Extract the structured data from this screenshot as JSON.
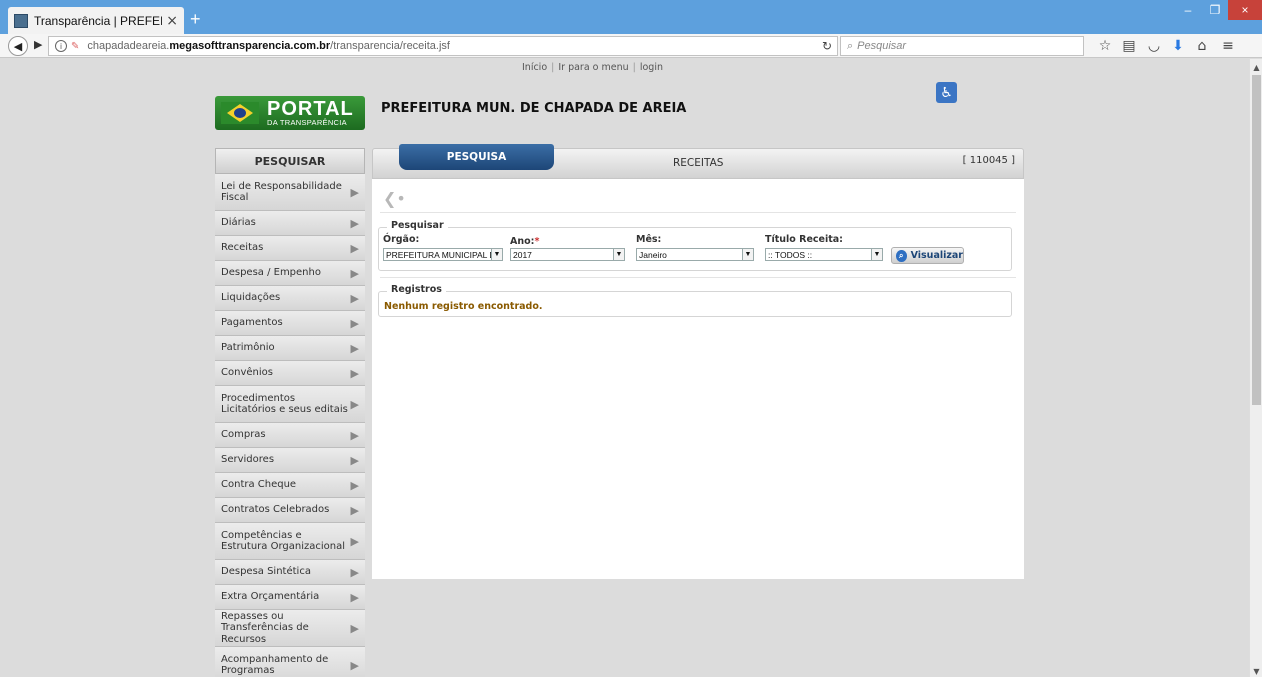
{
  "browser": {
    "tab_title": "Transparência | PREFEITU...",
    "tab_close": "×",
    "new_tab": "+",
    "window_buttons": {
      "minimize": "–",
      "restore": "❐",
      "close": "×"
    },
    "url_host": "chapadadeareia.",
    "url_strong": "megasofttransparencia.com.br",
    "url_path": "/transparencia/receita.jsf",
    "search_placeholder": "Pesquisar"
  },
  "toplinks": {
    "inicio": "Início",
    "menu": "Ir para o menu",
    "login": "login"
  },
  "logo": {
    "main": "PORTAL",
    "sub": "DA TRANSPARÊNCIA"
  },
  "page_title": "PREFEITURA MUN. DE CHAPADA DE AREIA",
  "sidebar": {
    "header": "PESQUISAR",
    "items": [
      {
        "label": "Lei de Responsabilidade Fiscal"
      },
      {
        "label": "Diárias"
      },
      {
        "label": "Receitas"
      },
      {
        "label": "Despesa / Empenho"
      },
      {
        "label": "Liquidações"
      },
      {
        "label": "Pagamentos"
      },
      {
        "label": "Patrimônio"
      },
      {
        "label": "Convênios"
      },
      {
        "label": "Procedimentos Licitatórios e seus editais"
      },
      {
        "label": "Compras"
      },
      {
        "label": "Servidores"
      },
      {
        "label": "Contra Cheque"
      },
      {
        "label": "Contratos Celebrados"
      },
      {
        "label": "Competências e Estrutura Organizacional"
      },
      {
        "label": "Despesa Sintética"
      },
      {
        "label": "Extra Orçamentária"
      },
      {
        "label": "Repasses ou Transferências de Recursos"
      },
      {
        "label": "Acompanhamento de Programas"
      }
    ]
  },
  "main": {
    "tab_pesquisa": "PESQUISA",
    "tab_receitas": "RECEITAS",
    "code": "[ 110045 ]",
    "pesquisar_legend": "Pesquisar",
    "orgao_label": "Órgão:",
    "orgao_value": "PREFEITURA MUNICIPAL D",
    "ano_label": "Ano:",
    "ano_required": "*",
    "ano_value": "2017",
    "mes_label": "Mês:",
    "mes_value": "Janeiro",
    "titulo_label": "Título Receita:",
    "titulo_value": ":: TODOS ::",
    "visualizar": "Visualizar",
    "registros_legend": "Registros",
    "no_records": "Nenhum registro encontrado."
  }
}
